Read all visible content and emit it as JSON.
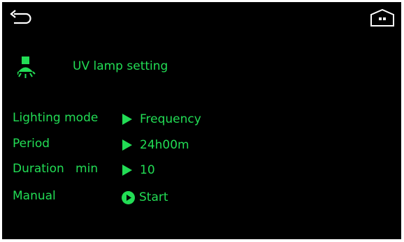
{
  "colors": {
    "background": "#000000",
    "accent": "#22dd55",
    "icon": "#ffffff"
  },
  "header": {
    "back_icon": "back-arrow-icon",
    "home_icon": "home-icon"
  },
  "title": {
    "text": "UV lamp setting",
    "icon": "uv-lamp-icon"
  },
  "settings": [
    {
      "label": "Lighting mode",
      "value": "Frequency",
      "control_icon": "triangle-right-icon"
    },
    {
      "label": "Period",
      "value": "24h00m",
      "control_icon": "triangle-right-icon"
    },
    {
      "label": "Duration   min",
      "value": "10",
      "control_icon": "triangle-right-icon"
    },
    {
      "label": "Manual",
      "value": "Start",
      "control_icon": "play-circle-icon"
    }
  ]
}
